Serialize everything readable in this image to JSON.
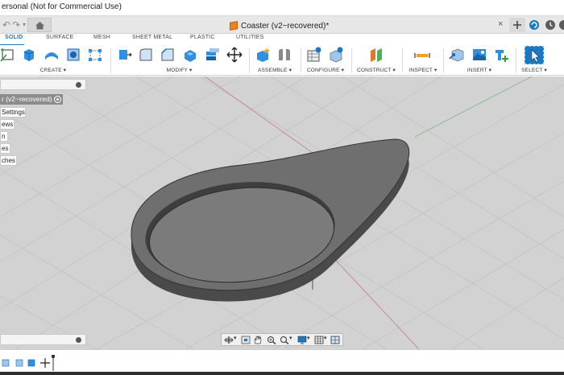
{
  "window": {
    "title": "ersonal (Not for Commercial Use)"
  },
  "document_tab": {
    "name": "Coaster (v2~recovered)*",
    "close_glyph": "×"
  },
  "ribbon": {
    "tabs": [
      "SOLID",
      "SURFACE",
      "MESH",
      "SHEET METAL",
      "PLASTIC",
      "UTILITIES"
    ],
    "active_tab": "SOLID",
    "groups": {
      "create": "CREATE ▾",
      "modify": "MODIFY ▾",
      "assemble": "ASSEMBLE ▾",
      "configure": "CONFIGURE ▾",
      "construct": "CONSTRUCT ▾",
      "inspect": "INSPECT ▾",
      "insert": "INSERT ▾",
      "select": "SELECT ▾"
    }
  },
  "browser": {
    "root_label": "r (v2~recovered)",
    "items": [
      "Settings",
      "ews",
      "n",
      "es",
      "ches"
    ]
  },
  "colors": {
    "accent": "#1b78c2",
    "viewport_bg": "#d2d2d2",
    "model_top": "#6f6f6f",
    "model_side": "#4a4a4a",
    "grid_line": "#bdbdbd"
  }
}
